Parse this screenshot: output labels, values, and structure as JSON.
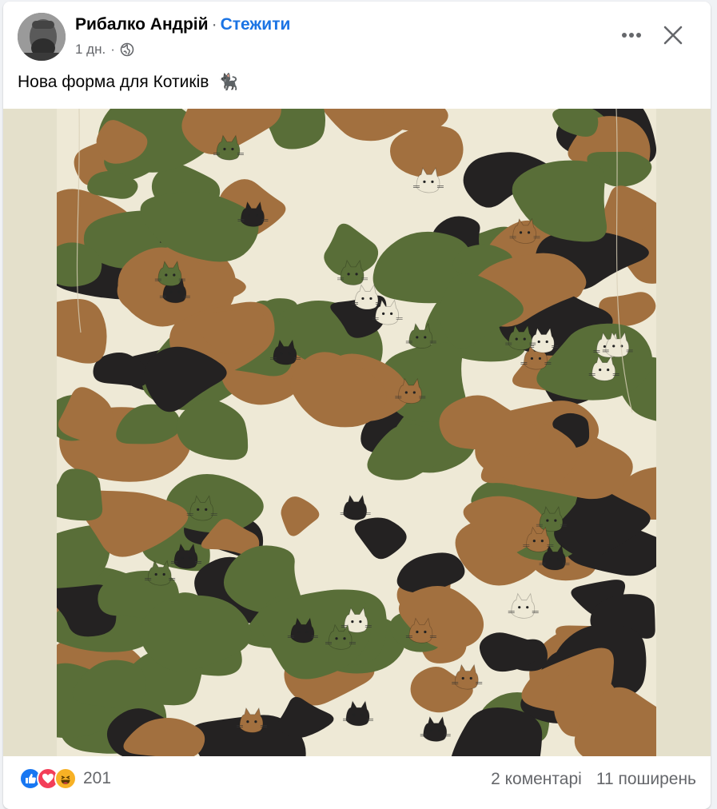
{
  "post": {
    "author": "Рибалко Андрій",
    "separator": "·",
    "follow_label": "Стежити",
    "time": "1 дн.",
    "meta_separator": "·",
    "audience_icon": "globe-icon",
    "text": "Нова форма для Котиків",
    "emoji": "🐈‍⬛"
  },
  "media": {
    "type": "image",
    "description_icon": "camouflage-cats-image"
  },
  "footer": {
    "reaction_icons": [
      "like-icon",
      "love-icon",
      "haha-icon"
    ],
    "reaction_count": "201",
    "comments": "2 коментарі",
    "shares": "11 поширень"
  },
  "colors": {
    "follow": "#1b74e4",
    "like": "#1877f2",
    "love": "#f33e58",
    "haha": "#f7b125",
    "camo_cream": "#eee9d6",
    "camo_green": "#596e38",
    "camo_brown": "#a2703f",
    "camo_black": "#242222"
  }
}
